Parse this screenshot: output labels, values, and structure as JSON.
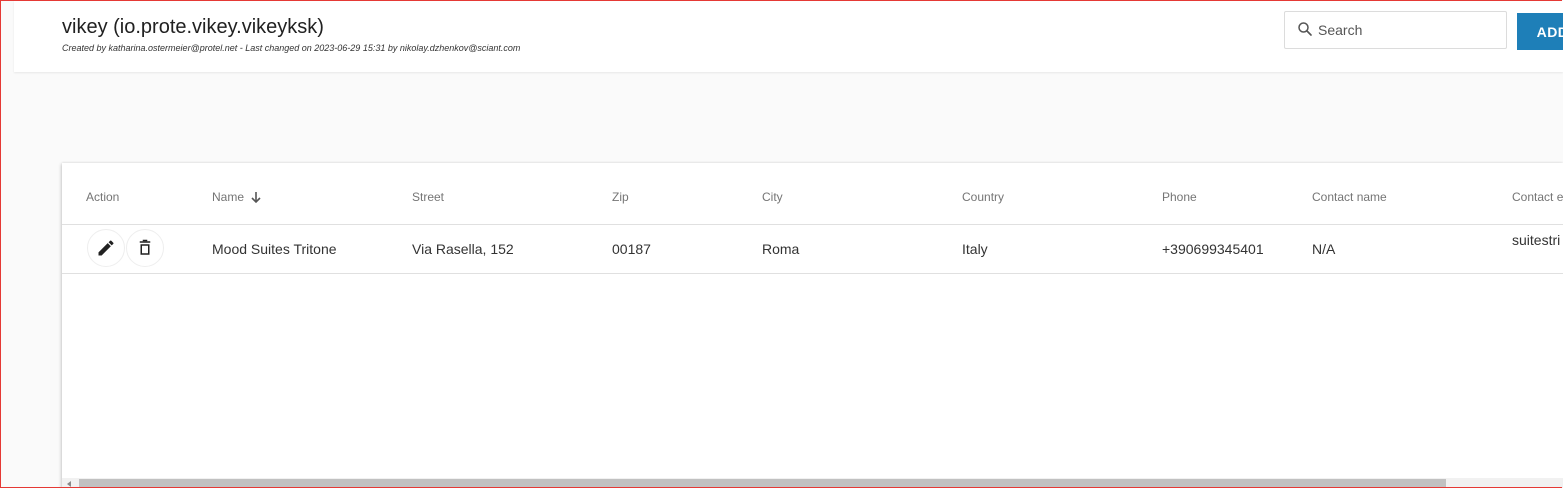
{
  "header": {
    "title": "vikey (io.prote.vikey.vikeyksk)",
    "subtitle": "Created by katharina.ostermeier@protel.net - Last changed on 2023-06-29 15:31 by nikolay.dzhenkov@sciant.com",
    "search_placeholder": "Search",
    "search_value": "",
    "add_label": "ADD"
  },
  "table": {
    "columns": [
      "Action",
      "Name",
      "Street",
      "Zip",
      "City",
      "Country",
      "Phone",
      "Contact name",
      "Contact e"
    ],
    "sort": {
      "column": "Name",
      "direction": "descending"
    },
    "rows": [
      {
        "name": "Mood Suites Tritone",
        "street": "Via Rasella, 152",
        "zip": "00187",
        "city": "Roma",
        "country": "Italy",
        "phone": "+390699345401",
        "contact_name": "N/A",
        "contact_email": "suitestri t"
      }
    ]
  },
  "icons": {
    "search": "search-icon",
    "edit": "pencil-icon",
    "delete": "trash-icon",
    "sort": "arrow-down-icon"
  },
  "colors": {
    "accent": "#1e7fb8",
    "frame": "#e53935"
  }
}
